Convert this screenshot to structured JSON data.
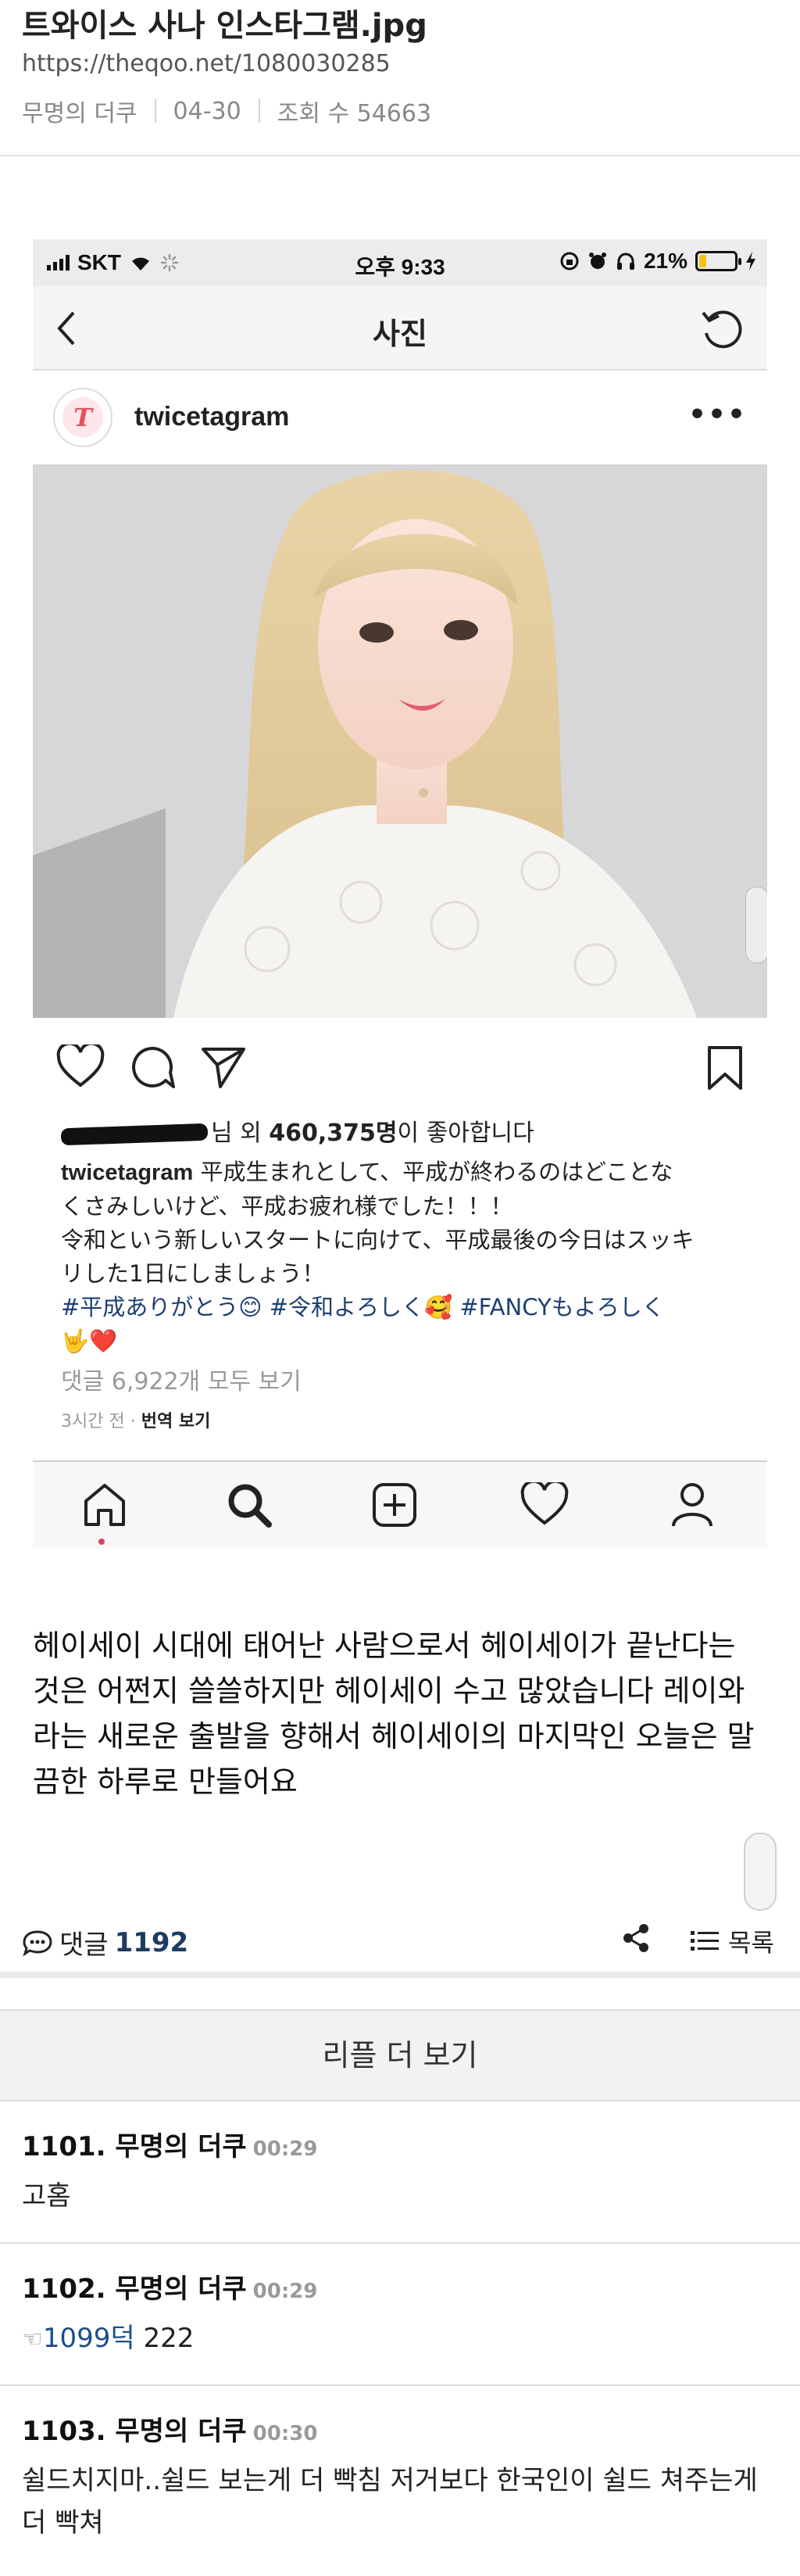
{
  "article": {
    "title": "트와이스 사나 인스타그램.jpg",
    "url": "https://theqoo.net/1080030285",
    "author": "무명의 더쿠",
    "date": "04-30",
    "views": "조회 수 54663"
  },
  "screenshot": {
    "status": {
      "carrier": "SKT",
      "time": "오후 9:33",
      "battery": "21%",
      "battery_level": 0.21
    },
    "nav_title": "사진",
    "username": "twicetagram",
    "avatar_letter": "T",
    "more": "•••",
    "likes_suffix": "님 외 ",
    "likes_count": "460,375명",
    "likes_tail": "이 좋아합니다",
    "caption_user": "twicetagram",
    "caption_line1": " 平成生まれとして、平成が終わるのはどことな",
    "caption_line2": "くさみしいけど、平成お疲れ様でした！！！",
    "caption_line3": "令和という新しいスタートに向けて、平成最後の今日はスッキ",
    "caption_line4": "リした1日にしましょう！",
    "hashtags_line1": "#平成ありがとう😊 #令和よろしく🥰 #FANCYもよろしく",
    "hashtags_line2": "🤟❤️",
    "comments_link": "댓글 6,922개 모두 보기",
    "time_ago": "3시간 전 · ",
    "translate": "번역 보기"
  },
  "body_text": "헤이세이 시대에 태어난 사람으로서 헤이세이가 끝난다는 것은 어쩐지 쓸쓸하지만 헤이세이 수고 많았습니다 레이와라는 새로운 출발을 향해서 헤이세이의 마지막인 오늘은 말끔한 하루로 만들어요",
  "comment_bar": {
    "label": "댓글",
    "count": "1192",
    "list_label": "목록"
  },
  "more_replies": "리플 더 보기",
  "comments": [
    {
      "num": "1101",
      "author": "무명의 더쿠",
      "time": "00:29",
      "text": "고홈"
    },
    {
      "num": "1102",
      "author": "무명의 더쿠",
      "time": "00:29",
      "ref": "1099덕",
      "text": " 222"
    },
    {
      "num": "1103",
      "author": "무명의 더쿠",
      "time": "00:30",
      "text": "쉴드치지마..쉴드 보는게 더 빡침 저거보다 한국인이 쉴드 쳐주는게 더 빡쳐"
    }
  ]
}
